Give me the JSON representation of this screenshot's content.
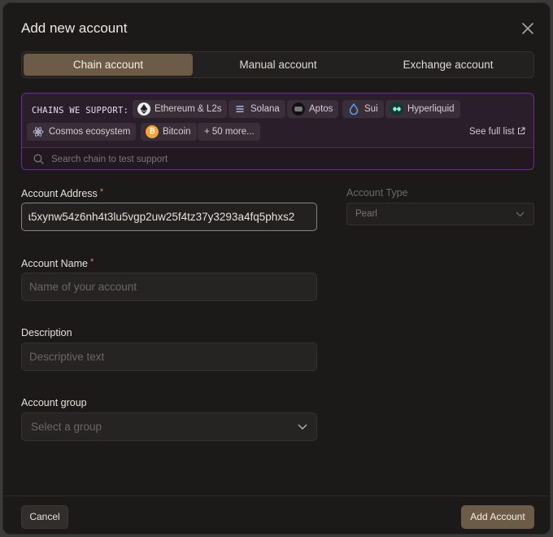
{
  "modal": {
    "title": "Add new account"
  },
  "tabs": [
    {
      "label": "Chain account",
      "active": true
    },
    {
      "label": "Manual account",
      "active": false
    },
    {
      "label": "Exchange account",
      "active": false
    }
  ],
  "chains": {
    "label": "CHAINS WE SUPPORT:",
    "items": [
      {
        "name": "Ethereum & L2s",
        "icon": "ethereum-icon"
      },
      {
        "name": "Solana",
        "icon": "solana-icon"
      },
      {
        "name": "Aptos",
        "icon": "aptos-icon"
      },
      {
        "name": "Sui",
        "icon": "sui-icon"
      },
      {
        "name": "Hyperliquid",
        "icon": "hyperliquid-icon"
      },
      {
        "name": "Cosmos ecosystem",
        "icon": "cosmos-icon"
      },
      {
        "name": "Bitcoin",
        "icon": "bitcoin-icon"
      }
    ],
    "more_label": "+ 50 more...",
    "see_full_label": "See full list",
    "search_placeholder": "Search chain to test support"
  },
  "form": {
    "address_label": "Account Address",
    "address_value": "ɩ5xynw54z6nh4t3lu5vgp2uw25f4tz37y3293a4fq5phxs2",
    "type_label": "Account Type",
    "type_value": "Pearl",
    "name_label": "Account Name",
    "name_placeholder": "Name of your account",
    "description_label": "Description",
    "description_placeholder": "Descriptive text",
    "group_label": "Account group",
    "group_placeholder": "Select a group",
    "required_mark": "*"
  },
  "footer": {
    "cancel_label": "Cancel",
    "add_label": "Add Account"
  },
  "colors": {
    "accent": "#6c5c47",
    "chains_border": "#63367a",
    "required": "#d08b57"
  }
}
